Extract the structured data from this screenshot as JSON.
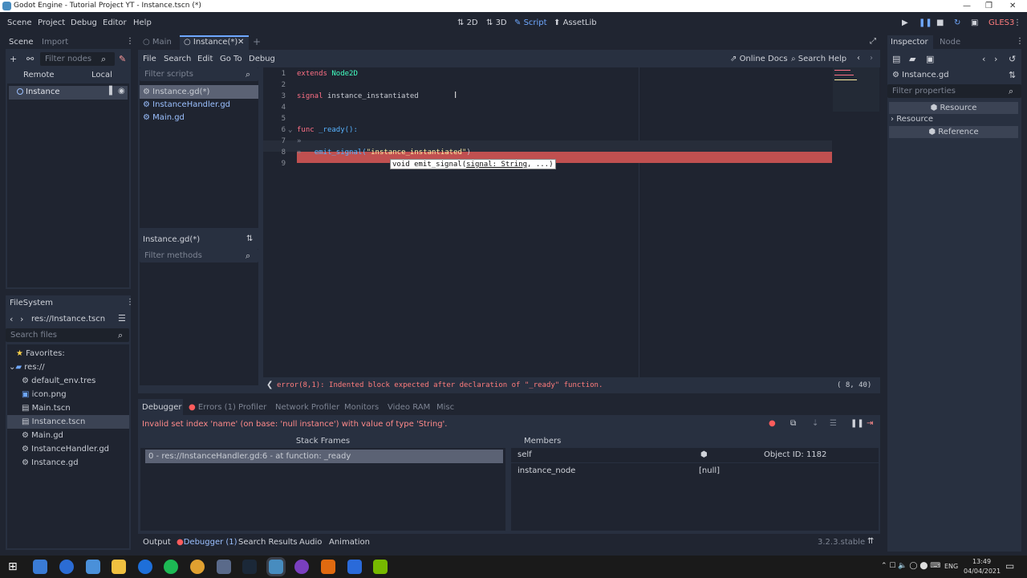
{
  "window": {
    "title": "Godot Engine - Tutorial Project YT - Instance.tscn (*)"
  },
  "menu": [
    "Scene",
    "Project",
    "Debug",
    "Editor",
    "Help"
  ],
  "modes": {
    "m2d": "2D",
    "m3d": "3D",
    "script": "Script",
    "assetlib": "AssetLib"
  },
  "renderer": "GLES3",
  "scene_dock": {
    "tab_scene": "Scene",
    "tab_import": "Import",
    "filter": "Filter nodes",
    "remote": "Remote",
    "local": "Local",
    "node": "Instance"
  },
  "filesystem": {
    "title": "FileSystem",
    "path": "res://Instance.tscn",
    "search": "Search files",
    "favorites": "Favorites:",
    "root": "res://",
    "files": [
      "default_env.tres",
      "icon.png",
      "Main.tscn",
      "Instance.tscn",
      "Main.gd",
      "InstanceHandler.gd",
      "Instance.gd"
    ]
  },
  "editor_tabs": {
    "main": "Main",
    "instance": "Instance(*)"
  },
  "script_menu": {
    "file": "File",
    "search": "Search",
    "edit": "Edit",
    "goto": "Go To",
    "debug": "Debug",
    "online_docs": "Online Docs",
    "search_help": "Search Help"
  },
  "script_list": {
    "filter": "Filter scripts",
    "items": [
      "Instance.gd(*)",
      "InstanceHandler.gd",
      "Main.gd"
    ],
    "current": "Instance.gd(*)",
    "filter_methods": "Filter methods"
  },
  "code": {
    "lines": [
      "1",
      "2",
      "3",
      "4",
      "5",
      "6",
      "7",
      "8",
      "9"
    ],
    "l1a": "extends",
    "l1b": "Node2D",
    "l3a": "signal",
    "l3b": "instance_instantiated",
    "l6a": "func",
    "l6b": "_ready():",
    "l8a": "emit_signal(",
    "l8b": "\"instance_instantiated\"",
    "l8c": ")",
    "tooltip_a": "void emit_signal(",
    "tooltip_b": "signal: String",
    ", ...)": "",
    "tooltip_c": ", ...)"
  },
  "status": {
    "error": "error(8,1): Indented block expected after declaration of \"_ready\" function.",
    "pos": "(  8, 40)"
  },
  "debugger": {
    "tabs": [
      "Debugger",
      "Errors (1)",
      "Profiler",
      "Network Profiler",
      "Monitors",
      "Video RAM",
      "Misc"
    ],
    "message": "Invalid set index 'name' (on base: 'null instance') with value of type 'String'.",
    "stack_title": "Stack Frames",
    "stack_frame": "0 - res://InstanceHandler.gd:6 - at function: _ready",
    "members_title": "Members",
    "self_label": "self",
    "self_value": "Object ID: 1182",
    "inst_label": "instance_node",
    "inst_value": "[null]"
  },
  "bottom_tabs": [
    "Output",
    "Debugger (1)",
    "Search Results",
    "Audio",
    "Animation"
  ],
  "version": "3.2.3.stable",
  "inspector": {
    "tab_inspector": "Inspector",
    "tab_node": "Node",
    "file": "Instance.gd",
    "filter": "Filter properties",
    "resource_header": "Resource",
    "resource_group": "Resource",
    "reference": "Reference"
  },
  "clock": {
    "time": "13:49",
    "date": "04/04/2021",
    "lang": "ENG"
  }
}
